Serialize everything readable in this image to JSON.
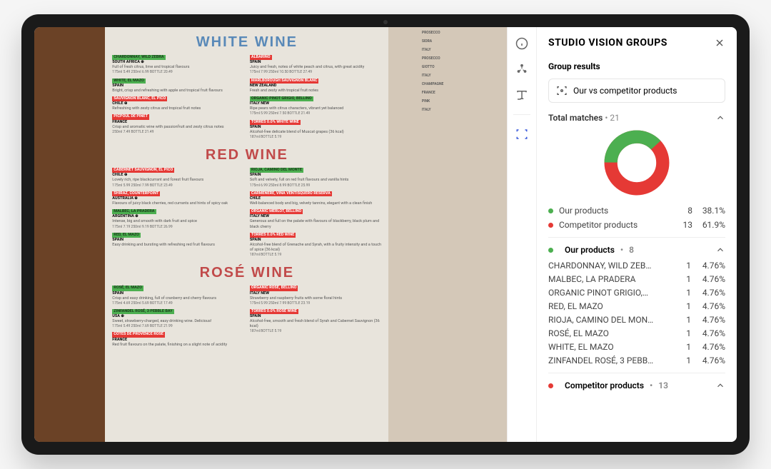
{
  "panel": {
    "title": "STUDIO VISION GROUPS",
    "group_results_label": "Group results",
    "active_group": "Our vs competitor products",
    "total_matches_label": "Total matches",
    "total_matches_count": "21",
    "legend": [
      {
        "name": "Our products",
        "count": "8",
        "pct": "38.1%",
        "color": "#4caf50"
      },
      {
        "name": "Competitor products",
        "count": "13",
        "pct": "61.9%",
        "color": "#e53935"
      }
    ],
    "sections": [
      {
        "name": "Our products",
        "count": "8",
        "color": "green",
        "items": [
          {
            "name": "CHARDONNAY, WILD ZEB…",
            "count": "1",
            "pct": "4.76%"
          },
          {
            "name": "MALBEC, LA PRADERA",
            "count": "1",
            "pct": "4.76%"
          },
          {
            "name": "ORGANIC PINOT GRIGIO,…",
            "count": "1",
            "pct": "4.76%"
          },
          {
            "name": "RED, EL MAZO",
            "count": "1",
            "pct": "4.76%"
          },
          {
            "name": "RIOJA, CAMINO DEL MON…",
            "count": "1",
            "pct": "4.76%"
          },
          {
            "name": "ROSÉ, EL MAZO",
            "count": "1",
            "pct": "4.76%"
          },
          {
            "name": "WHITE, EL MAZO",
            "count": "1",
            "pct": "4.76%"
          },
          {
            "name": "ZINFANDEL ROSÉ, 3 PEBB…",
            "count": "1",
            "pct": "4.76%"
          }
        ]
      },
      {
        "name": "Competitor products",
        "count": "13",
        "color": "red",
        "items": []
      }
    ]
  },
  "chart_data": {
    "type": "pie",
    "title": "Total matches",
    "series": [
      {
        "name": "Our products",
        "value": 8,
        "pct": 38.1,
        "color": "#4caf50"
      },
      {
        "name": "Competitor products",
        "value": 13,
        "pct": 61.9,
        "color": "#e53935"
      }
    ]
  },
  "menu": {
    "white": {
      "heading": "WHITE WINE",
      "left": [
        {
          "name": "CHARDONNAY, WILD ZEBRA",
          "hl": "green",
          "origin": "SOUTH AFRICA ⊕",
          "desc": "Full of fresh citrus, lime and tropical flavours",
          "price": "175ml 5.49  250ml 6.99  BOTTLE 20.49"
        },
        {
          "name": "WHITE, EL MAZO",
          "hl": "green",
          "origin": "SPAIN",
          "desc": "Bright, crisp and refreshing with apple and tropical fruit flavours",
          "price": ""
        },
        {
          "name": "SAUVIGNON BLANC, EL PICO",
          "hl": "red",
          "origin": "CHILE ⊕",
          "desc": "Refreshing with zesty citrus and tropical fruit notes",
          "price": ""
        },
        {
          "name": "PICPOUL DE PINET",
          "hl": "red",
          "origin": "FRANCE",
          "desc": "Crisp and aromatic wine with passionfruit and zesty citrus notes",
          "price": "250ml 7.49  BOTTLE 21.49"
        }
      ],
      "right": [
        {
          "name": "ALBARIÑO",
          "hl": "red",
          "origin": "SPAIN",
          "desc": "Juicy and fresh, notes of white peach and citrus, with great acidity",
          "price": "175ml 7.99  250ml 10.50  BOTTLE 27.49"
        },
        {
          "name": "MARLBOROUGH SAUVIGNON BLANC",
          "hl": "red",
          "origin": "NEW ZEALAND",
          "desc": "Fresh and zesty with tropical fruit notes",
          "price": ""
        },
        {
          "name": "ORGANIC PINOT GRIGIO, BELLINO",
          "hl": "green",
          "origin": "ITALY NEW",
          "desc": "Ripe pears with citrus characters, vibrant yet balanced",
          "price": "175ml 5.99  250ml 7.50  BOTTLE 21.49"
        },
        {
          "name": "TORRES 0.0% WHITE WINE",
          "hl": "red",
          "origin": "SPAIN",
          "desc": "Alcohol-free delicate blend of Muscat grapes (36 kcal)",
          "price": "187ml BOTTLE 5.19"
        }
      ]
    },
    "red": {
      "heading": "RED WINE",
      "left": [
        {
          "name": "CABERNET SAUVIGNON, EL PICO",
          "hl": "red",
          "origin": "CHILE ⊕",
          "desc": "Lovely rich, ripe blackcurrant and forest fruit flavours",
          "price": "175ml 5.99  250ml 7.99  BOTTLE 23.49"
        },
        {
          "name": "SHIRAZ, COUNTERPOINT",
          "hl": "red",
          "origin": "AUSTRALIA ⊕",
          "desc": "Flavours of juicy black cherries, red currants and hints of spicy oak",
          "price": ""
        },
        {
          "name": "MALBEC, LA PRADERA",
          "hl": "green",
          "origin": "ARGENTINA ⊕",
          "desc": "Intense, big and smooth with dark fruit and spice",
          "price": "175ml 7.19  250ml 9.19  BOTTLE 26.99"
        },
        {
          "name": "RED, EL MAZO",
          "hl": "green",
          "origin": "SPAIN",
          "desc": "Easy drinking and bursting with refreshing red fruit flavours",
          "price": ""
        }
      ],
      "right": [
        {
          "name": "RIOJA, CAMINO DEL MONTE",
          "hl": "green",
          "origin": "SPAIN",
          "desc": "Soft and velvety, full on red fruit flavours and vanilla hints",
          "price": "175ml 6.99  250ml 8.99  BOTTLE 25.99"
        },
        {
          "name": "CARMENERE, VIÑA VENTISQUERO RESERVA",
          "hl": "red",
          "origin": "CHILE",
          "desc": "Well-balanced body and big, velvety tannins, elegant with a clean finish",
          "price": ""
        },
        {
          "name": "ORGANIC MERLOT, BELLINO",
          "hl": "red",
          "origin": "ITALY NEW",
          "desc": "Generous and full on the palate with flavours of blackberry, black plum and black cherry",
          "price": ""
        },
        {
          "name": "TORRES 0.0% RED WINE",
          "hl": "red",
          "origin": "SPAIN",
          "desc": "Alcohol-free blend of Grenache and Syrah, with a fruity intensity and a touch of spice (36 kcal)",
          "price": "187ml BOTTLE 5.19"
        }
      ]
    },
    "rose": {
      "heading": "ROSÉ WINE",
      "left": [
        {
          "name": "ROSÉ, EL MAZO",
          "hl": "green",
          "origin": "SPAIN",
          "desc": "Crisp and easy drinking, full of cranberry and cherry flavours",
          "price": "175ml 4.69  250ml 5.69  BOTTLE 17.49"
        },
        {
          "name": "ZINFANDEL ROSÉ, 3 PEBBLE BAY",
          "hl": "green",
          "origin": "USA ⊕",
          "desc": "Sweet, strawberry-charged, easy drinking wine. Delicious!",
          "price": "175ml 5.49  250ml 7.69  BOTTLE 21.99"
        },
        {
          "name": "CÔTES DE PROVENCE ROSÉ",
          "hl": "red",
          "origin": "FRANCE",
          "desc": "Red fruit flavours on the palate, finishing on a slight note of acidity",
          "price": ""
        }
      ],
      "right": [
        {
          "name": "ORGANIC ROSÉ, BELLINO",
          "hl": "red",
          "origin": "ITALY NEW",
          "desc": "Strawberry and raspberry fruits with some floral hints",
          "price": "175ml 5.99  250ml 7.99  BOTTLE 23.19"
        },
        {
          "name": "TORRES 0.0% ROSÉ WINE",
          "hl": "red",
          "origin": "SPAIN",
          "desc": "Alcohol-free, smooth and fresh blend of Syrah and Cabernet Sauvignon (36 kcal)",
          "price": "187ml BOTTLE 5.19"
        }
      ]
    },
    "strip": [
      "PROSECCO",
      "SIDRA",
      "ITALY",
      "PROSECCO",
      "GIOTTO",
      "ITALY",
      "CHAMPAGNE",
      "FRANCE",
      "PINK",
      "ITALY"
    ]
  }
}
